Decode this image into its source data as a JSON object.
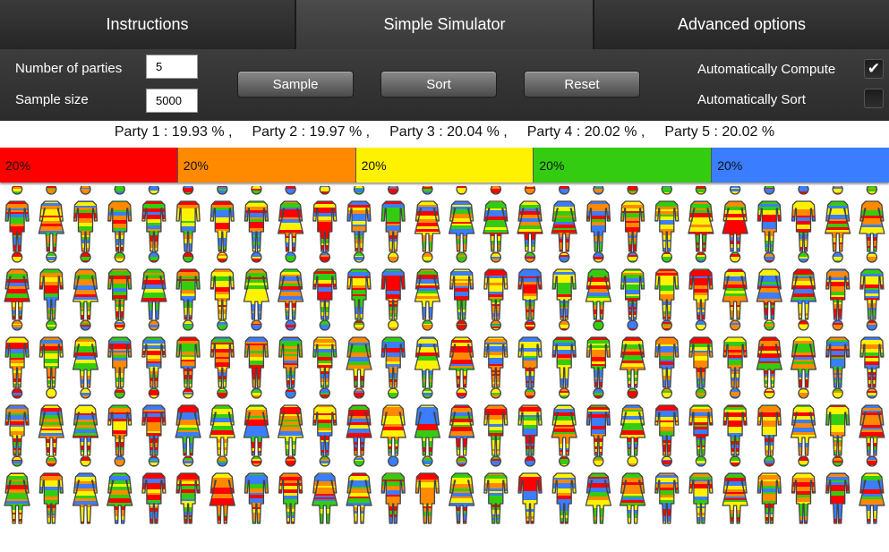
{
  "tabs": [
    {
      "label": "Instructions"
    },
    {
      "label": "Simple Simulator"
    },
    {
      "label": "Advanced options"
    }
  ],
  "controls": {
    "parties_label": "Number of parties",
    "parties_value": "5",
    "sample_label": "Sample size",
    "sample_value": "5000",
    "sample_button": "Sample",
    "sort_button": "Sort",
    "reset_button": "Reset",
    "auto_compute_label": "Automatically Compute",
    "auto_compute_checked": true,
    "auto_compute_mark": "✔",
    "auto_sort_label": "Automatically Sort",
    "auto_sort_checked": false
  },
  "results": [
    {
      "text": "Party 1 : 19.93 % ,"
    },
    {
      "text": "Party 2 : 19.97 % ,"
    },
    {
      "text": "Party 3 : 20.04 % ,"
    },
    {
      "text": "Party 4 : 20.02 % ,"
    },
    {
      "text": "Party 5 : 20.02 %"
    }
  ],
  "bar": [
    {
      "label": "20%",
      "color": "#ff0000"
    },
    {
      "label": "20%",
      "color": "#ff8a00"
    },
    {
      "label": "20%",
      "color": "#fff200"
    },
    {
      "label": "20%",
      "color": "#33cc11"
    },
    {
      "label": "20%",
      "color": "#3a7dff"
    }
  ],
  "figures": {
    "rows": 5,
    "cols": 26,
    "palette": [
      "#ff0000",
      "#ff8a00",
      "#fff200",
      "#33cc11",
      "#3a7dff"
    ],
    "icons": [
      "man-icon",
      "woman-icon"
    ]
  }
}
